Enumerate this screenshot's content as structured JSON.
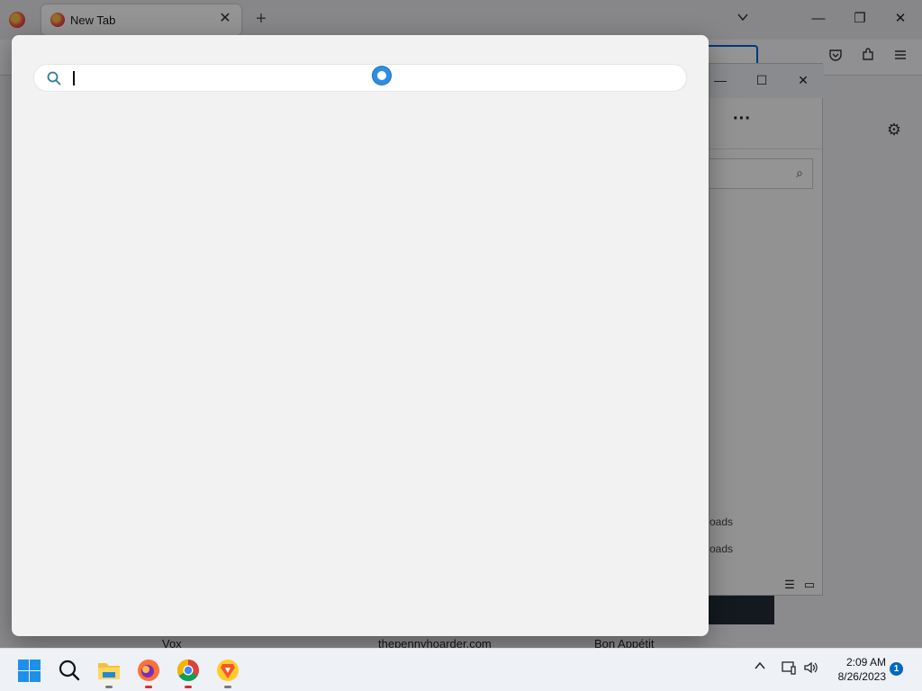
{
  "browser": {
    "tab": {
      "title": "New Tab",
      "close_glyph": "✕"
    },
    "new_tab_glyph": "+",
    "list_tabs_glyph": "⌄",
    "window_controls": {
      "minimize": "—",
      "maximize": "❐",
      "close": "✕"
    },
    "toolbar_icons": [
      "pocket-icon",
      "extensions-icon",
      "menu-icon"
    ],
    "settings_icon": "gear-icon"
  },
  "tiles": [
    "Vox",
    "thepennyhoarder.com",
    "Bon Appétit"
  ],
  "explorer": {
    "more_label": "···",
    "window_controls": {
      "minimize": "—",
      "maximize": "☐",
      "close": "✕"
    },
    "partial_items": [
      "oads",
      "oads"
    ],
    "search_icon": "search-icon"
  },
  "search_overlay": {
    "input_value": "",
    "input_placeholder": "",
    "accent_color": "#2d7d9a"
  },
  "taskbar": {
    "apps": [
      "start",
      "search",
      "file-explorer",
      "firefox",
      "chrome",
      "brave"
    ],
    "clock": {
      "time": "2:09 AM",
      "date": "8/26/2023"
    },
    "notification_count": "1"
  }
}
